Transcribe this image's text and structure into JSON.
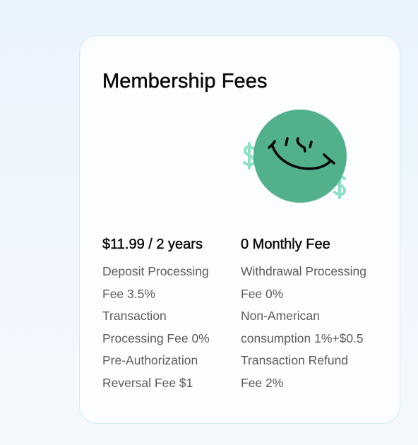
{
  "card": {
    "title": "Membership Fees",
    "illustration_icon": "smiley-face-with-dollar-signs",
    "colors": {
      "smiley_fill": "#52b08b",
      "dollar_sign": "#8fdfc5",
      "card_border": "#cfeaf0",
      "heading_text": "#0b0b0b",
      "body_text": "#5c5c5c"
    },
    "columns": [
      {
        "heading": "$11.99 / 2 years",
        "lines": [
          "Deposit Processing",
          "Fee 3.5%",
          "Transaction",
          "Processing Fee 0%",
          "Pre-Authorization",
          "Reversal Fee $1"
        ]
      },
      {
        "heading": "0 Monthly Fee",
        "lines": [
          "Withdrawal Processing",
          "Fee 0%",
          "Non-American",
          "consumption 1%+$0.5",
          "Transaction Refund",
          "Fee 2%"
        ]
      }
    ]
  }
}
